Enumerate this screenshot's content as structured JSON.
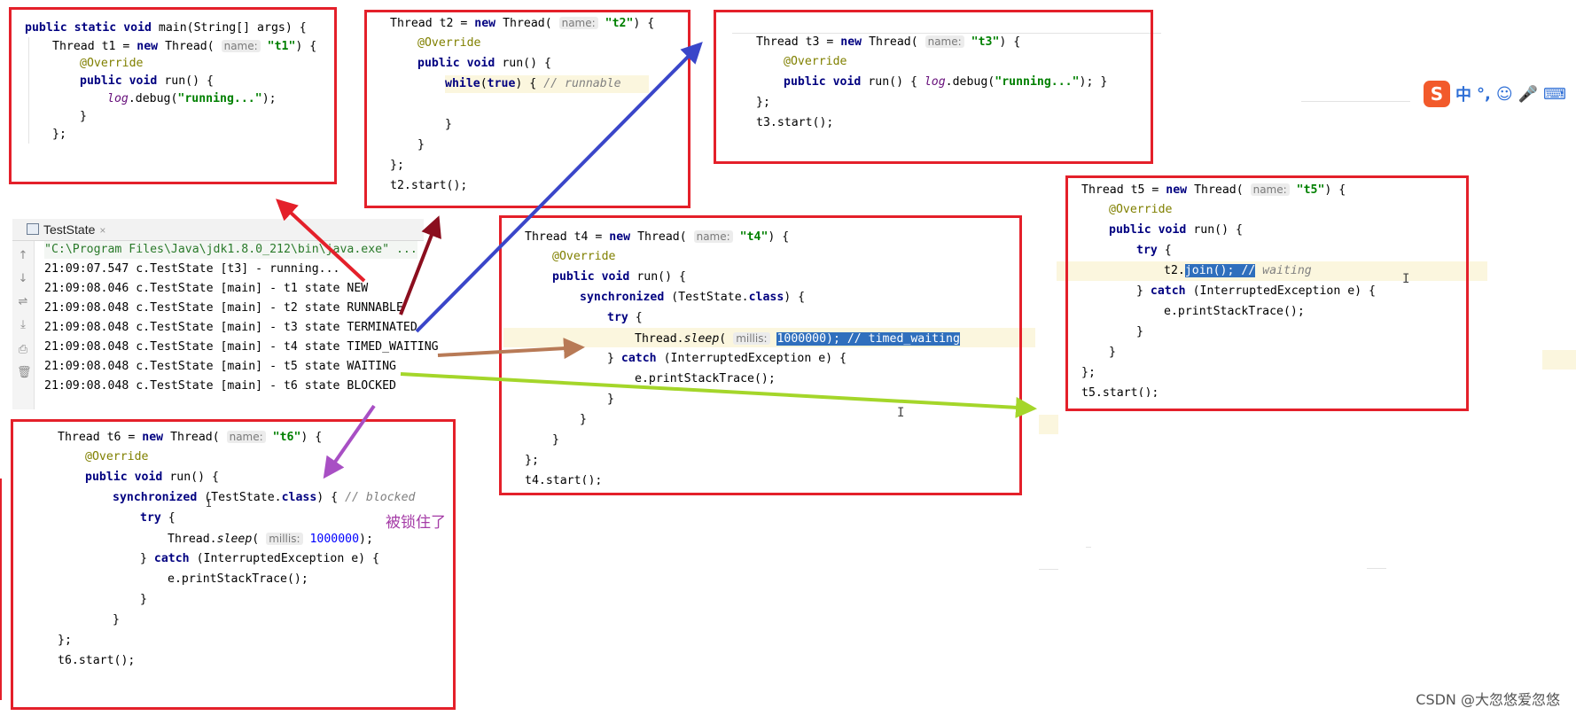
{
  "keywords": {
    "public": "public",
    "static": "static",
    "void": "void",
    "new": "new",
    "while": "while",
    "true": "true",
    "synchronized": "synchronized",
    "try": "try",
    "catch": "catch",
    "class": "class"
  },
  "t1_block": {
    "main_sig": "main(String[] args) {",
    "decl": "Thread t1 = ",
    "thread_call": "Thread(",
    "hint": "name:",
    "name": "\"t1\"",
    "tail": ") {",
    "override": "@Override",
    "run": "run() {",
    "log": "log",
    "debug": ".debug(",
    "msg": "\"running...\"",
    "end": ");",
    "close_brace": "}",
    "close_semi": "};"
  },
  "t2_block": {
    "decl": "Thread t2 = ",
    "thread_call": "Thread(",
    "hint": "name:",
    "name": "\"t2\"",
    "tail": ") {",
    "override": "@Override",
    "run": "run() {",
    "while_cond": "(",
    "while_tail": ") {",
    "comment": "// runnable",
    "close_brace": "}",
    "close_semi": "};",
    "start": "t2.start();"
  },
  "t3_block": {
    "decl": "Thread t3 = ",
    "thread_call": "Thread(",
    "hint": "name:",
    "name": "\"t3\"",
    "tail": ") {",
    "override": "@Override",
    "run": "run() {",
    "log": "log",
    "debug": ".debug(",
    "msg": "\"running...\"",
    "end": "); }",
    "close_semi": "};",
    "start": "t3.start();"
  },
  "t4_block": {
    "decl": "Thread t4 = ",
    "thread_call": "Thread(",
    "hint": "name:",
    "name": "\"t4\"",
    "tail": ") {",
    "override": "@Override",
    "run": "run() {",
    "sync_arg": "(TestState.",
    "sync_tail": ") {",
    "try_open": "{",
    "sleep_obj": "Thread.",
    "sleep": "sleep",
    "sleep_open": "(",
    "sleep_hint": "millis:",
    "sleep_selected": "1000000); // timed_waiting",
    "catch_open": "}",
    "catch_arg": "(InterruptedException e) {",
    "print": "e.printStackTrace();",
    "close_brace": "}",
    "close_semi": "};",
    "start": "t4.start();"
  },
  "t5_block": {
    "decl": "Thread t5 = ",
    "thread_call": "Thread(",
    "hint": "name:",
    "name": "\"t5\"",
    "tail": ") {",
    "override": "@Override",
    "run": "run() {",
    "try_open": "{",
    "join_obj": "t2.",
    "join_selected": "join(); //",
    "join_comment": " waiting",
    "catch_open": "}",
    "catch_arg": "(InterruptedException e) {",
    "print": "e.printStackTrace();",
    "close_brace": "}",
    "close_semi": "};",
    "start": "t5.start();"
  },
  "t6_block": {
    "decl": "Thread t6 = ",
    "thread_call": "Thread(",
    "hint": "name:",
    "name": "\"t6\"",
    "tail": ") {",
    "override": "@Override",
    "run": "run() {",
    "sync_arg": "(TestState.",
    "sync_tail": ") {",
    "comment": "// blocked",
    "try_open": "{",
    "sleep_obj": "Thread.",
    "sleep": "sleep",
    "sleep_open": "(",
    "sleep_hint": "millis:",
    "sleep_value": "1000000",
    "sleep_end": ");",
    "catch_open": "}",
    "catch_arg": "(InterruptedException e) {",
    "print": "e.printStackTrace();",
    "close_brace": "}",
    "close_semi": "};",
    "start": "t6.start();"
  },
  "console": {
    "tab_title": "TestState",
    "tab_close": "×",
    "command": "\"C:\\Program Files\\Java\\jdk1.8.0_212\\bin\\java.exe\" ...",
    "lines": [
      "21:09:07.547 c.TestState [t3] - running...",
      "21:09:08.046 c.TestState [main] - t1 state NEW",
      "21:09:08.048 c.TestState [main] - t2 state RUNNABLE",
      "21:09:08.048 c.TestState [main] - t3 state TERMINATED",
      "21:09:08.048 c.TestState [main] - t4 state TIMED_WAITING",
      "21:09:08.048 c.TestState [main] - t5 state WAITING",
      "21:09:08.048 c.TestState [main] - t6 state BLOCKED"
    ]
  },
  "annotation_blocked": "被锁住了",
  "ime": {
    "logo": "S",
    "items": [
      "中",
      "°,",
      "☺",
      "🎤",
      "⌨"
    ]
  },
  "watermark": "CSDN @大忽悠爱忽悠",
  "colors": {
    "box_red": "#e4202a",
    "arrow_t1": "#e4202a",
    "arrow_t2": "#8b0e1e",
    "arrow_t3": "#3a46c9",
    "arrow_t4": "#b87a56",
    "arrow_t5": "#a4d62a",
    "arrow_t6": "#a84fc4"
  }
}
